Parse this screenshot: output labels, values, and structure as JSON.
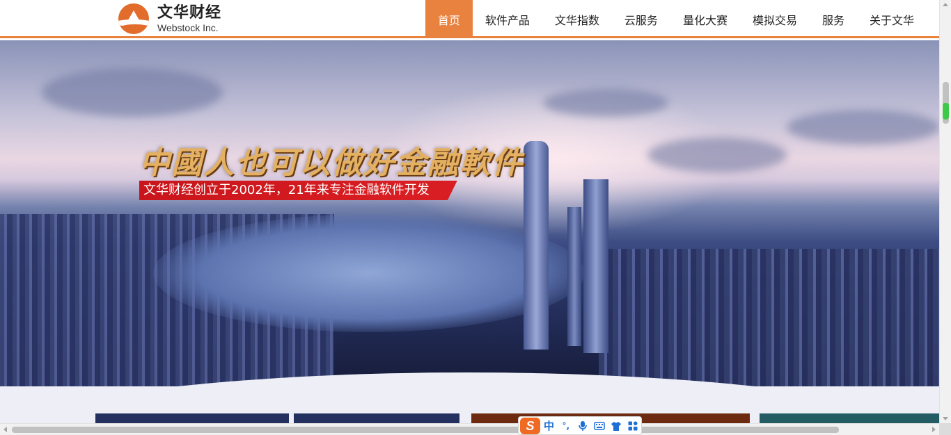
{
  "header": {
    "logo_cn": "文华财经",
    "logo_en": "Webstock Inc.",
    "accent": "#e9823e"
  },
  "nav": {
    "items": [
      {
        "label": "首页",
        "active": true
      },
      {
        "label": "软件产品",
        "active": false
      },
      {
        "label": "文华指数",
        "active": false
      },
      {
        "label": "云服务",
        "active": false
      },
      {
        "label": "量化大赛",
        "active": false
      },
      {
        "label": "模拟交易",
        "active": false
      },
      {
        "label": "服务",
        "active": false
      },
      {
        "label": "关于文华",
        "active": false
      }
    ]
  },
  "hero": {
    "slogan": "中國人也可以做好金融軟件",
    "subtitle": "文华财经创立于2002年，21年来专注金融软件开发"
  },
  "cards": [
    {
      "color": "#243160"
    },
    {
      "color": "#243160"
    },
    {
      "color": "#6e2a10"
    },
    {
      "color": "#235d63"
    }
  ],
  "ime": {
    "logo": "S",
    "mode": "中",
    "punct": "°,",
    "icons": [
      "microphone-icon",
      "keyboard-icon",
      "tshirt-icon",
      "grid-icon"
    ]
  }
}
